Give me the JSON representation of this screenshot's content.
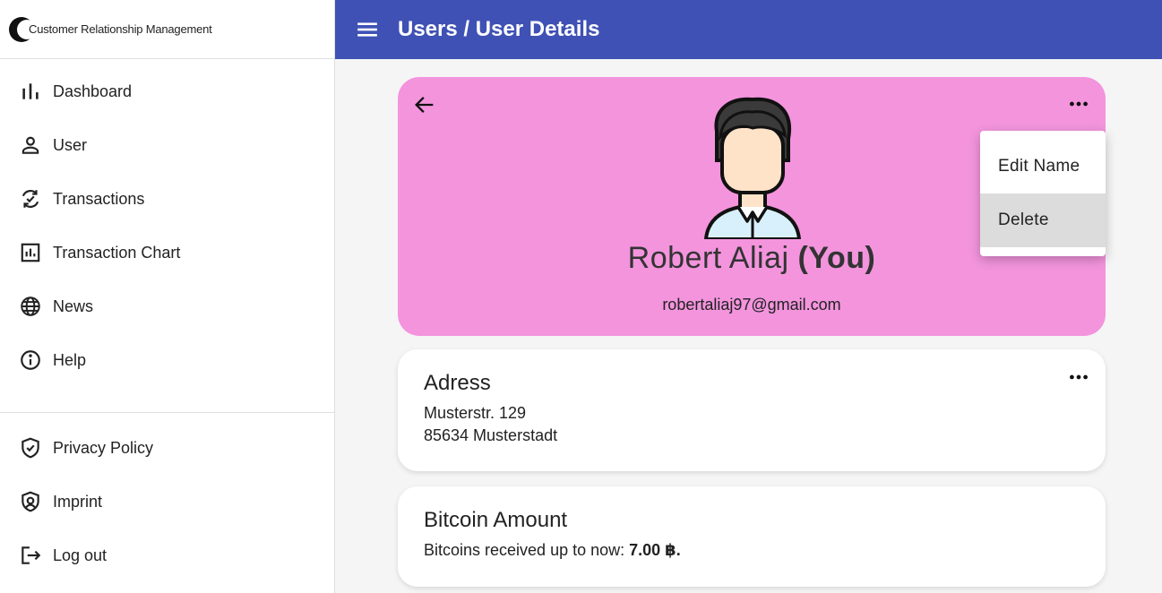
{
  "app": {
    "logo_text": "Customer Relationship Management",
    "page_title": "Users / User Details"
  },
  "sidebar": {
    "items": [
      {
        "label": "Dashboard",
        "icon": "bar-chart-icon"
      },
      {
        "label": "User",
        "icon": "person-icon"
      },
      {
        "label": "Transactions",
        "icon": "sync-check-icon"
      },
      {
        "label": "Transaction Chart",
        "icon": "chart-box-icon"
      },
      {
        "label": "News",
        "icon": "globe-icon"
      },
      {
        "label": "Help",
        "icon": "info-icon"
      }
    ],
    "bottom_items": [
      {
        "label": "Privacy Policy",
        "icon": "shield-check-icon"
      },
      {
        "label": "Imprint",
        "icon": "shield-person-icon"
      },
      {
        "label": "Log out",
        "icon": "logout-icon"
      }
    ]
  },
  "profile": {
    "name": "Robert Aliaj",
    "you_label": "(You)",
    "email": "robertaliaj97@gmail.com"
  },
  "menu": {
    "items": [
      "Edit Name",
      "Delete"
    ]
  },
  "address": {
    "title": "Adress",
    "street": "Musterstr. 129",
    "city": "85634 Musterstadt"
  },
  "bitcoin": {
    "title": "Bitcoin Amount",
    "text": "Bitcoins received up to now:",
    "amount": "7.00 ฿."
  },
  "colors": {
    "topbar": "#3f51b5",
    "profile_card": "#f394dd"
  }
}
